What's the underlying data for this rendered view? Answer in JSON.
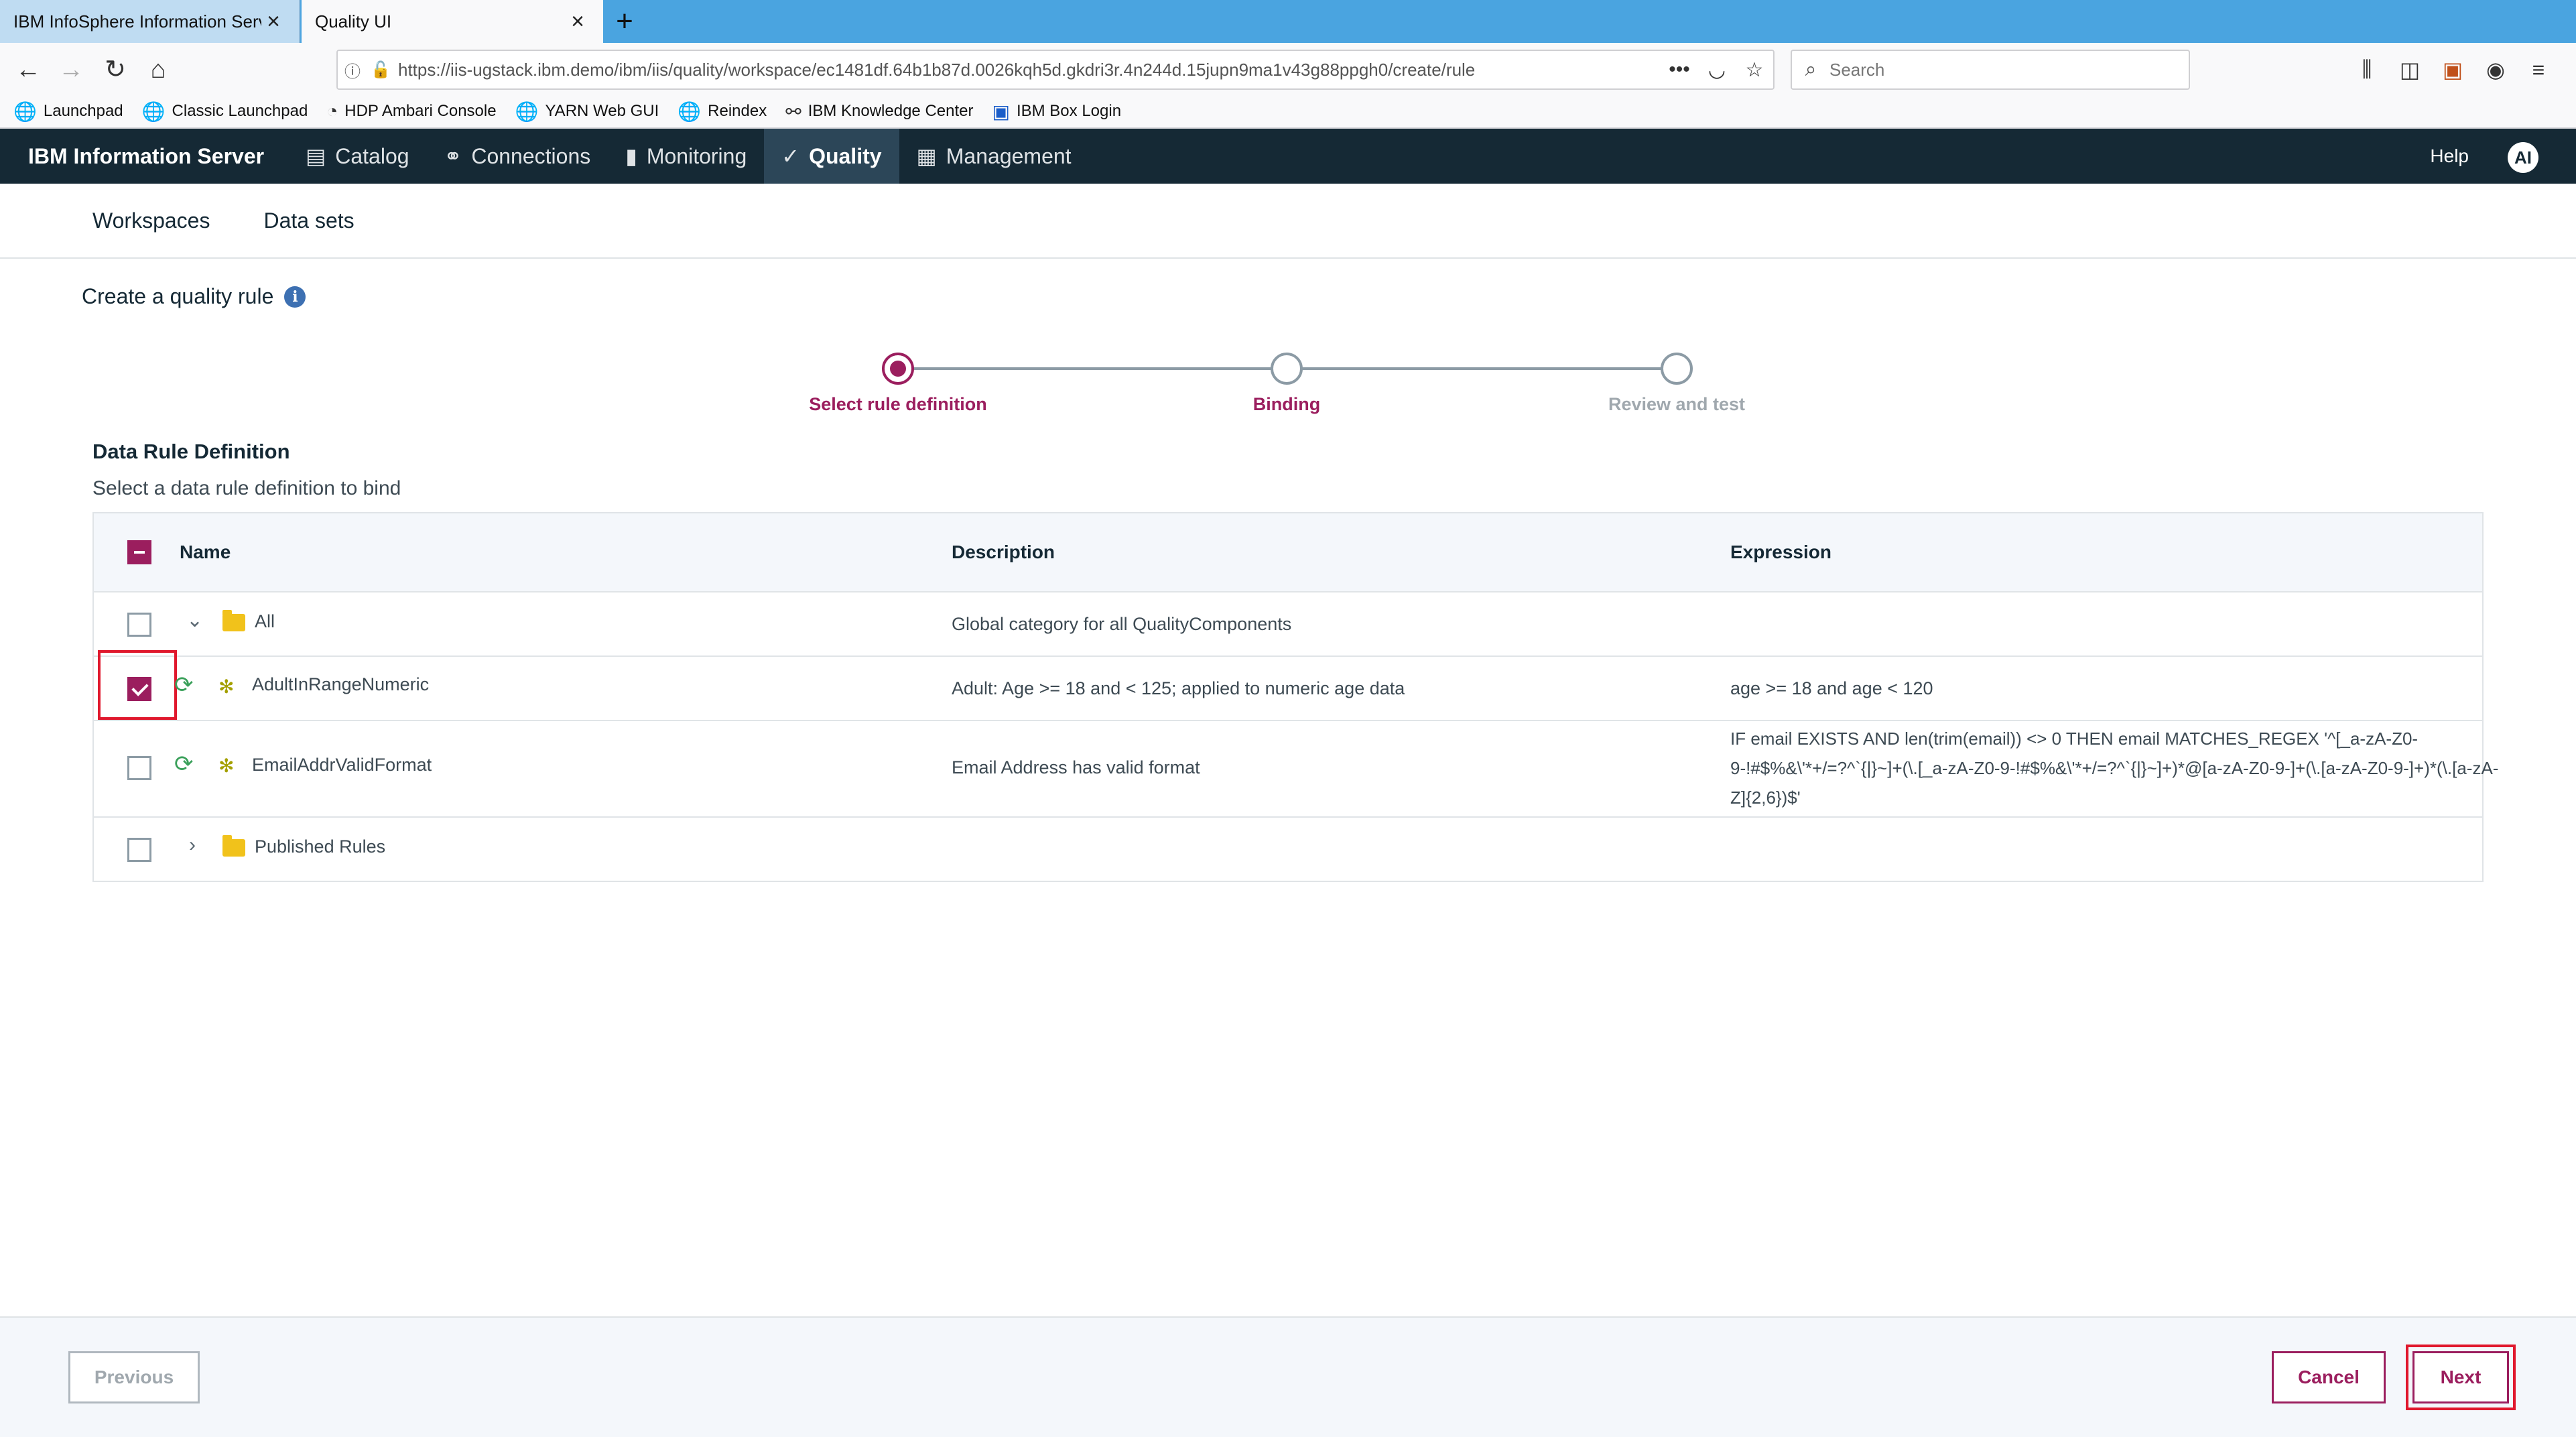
{
  "browser": {
    "tabs": [
      {
        "label": "IBM InfoSphere Information Server",
        "active": false
      },
      {
        "label": "Quality UI",
        "active": true
      }
    ],
    "url": "https://iis-ugstack.ibm.demo/ibm/iis/quality/workspace/ec1481df.64b1b87d.0026kqh5d.gkdri3r.4n244d.15jupn9ma1v43g88ppgh0/create/rule",
    "search_placeholder": "Search",
    "bookmarks": [
      {
        "label": "Launchpad",
        "icon": "globe-icon"
      },
      {
        "label": "Classic Launchpad",
        "icon": "globe-icon"
      },
      {
        "label": "HDP Ambari Console",
        "icon": "ambari-icon"
      },
      {
        "label": "YARN Web GUI",
        "icon": "globe-icon"
      },
      {
        "label": "Reindex",
        "icon": "globe-icon"
      },
      {
        "label": "IBM Knowledge Center",
        "icon": "knowledge-icon"
      },
      {
        "label": "IBM Box Login",
        "icon": "box-icon"
      }
    ]
  },
  "app": {
    "brand": "IBM Information Server",
    "nav": [
      {
        "label": "Catalog",
        "icon": "catalog-icon",
        "active": false
      },
      {
        "label": "Connections",
        "icon": "connections-icon",
        "active": false
      },
      {
        "label": "Monitoring",
        "icon": "monitoring-icon",
        "active": false
      },
      {
        "label": "Quality",
        "icon": "quality-check-icon",
        "active": true
      },
      {
        "label": "Management",
        "icon": "management-icon",
        "active": false
      }
    ],
    "help": "Help",
    "avatar": "AI"
  },
  "subnav": [
    "Workspaces",
    "Data sets"
  ],
  "page": {
    "title": "Create a quality rule",
    "steps": [
      {
        "label": "Select rule definition",
        "state": "current"
      },
      {
        "label": "Binding",
        "state": "next"
      },
      {
        "label": "Review and test",
        "state": "future"
      }
    ],
    "section_title": "Data Rule Definition",
    "section_subtitle": "Select a data rule definition to bind"
  },
  "table": {
    "columns": [
      "Name",
      "Description",
      "Expression"
    ],
    "rows": [
      {
        "type": "folder",
        "expanded": true,
        "name": "All",
        "description": "Global category for all QualityComponents",
        "expression": "",
        "checked": false
      },
      {
        "type": "rule",
        "name": "AdultInRangeNumeric",
        "description": "Adult: Age >= 18 and < 125; applied to numeric age data",
        "expression": "age >= 18 and age < 120",
        "checked": true
      },
      {
        "type": "rule",
        "name": "EmailAddrValidFormat",
        "description": "Email Address has valid format",
        "expression": "IF email EXISTS AND len(trim(email)) <> 0 THEN email MATCHES_REGEX '^[_a-zA-Z0-9-!#$%&\\'*+/=?^`{|}~]+(\\.[_a-zA-Z0-9-!#$%&\\'*+/=?^`{|}~]+)*@[a-zA-Z0-9-]+(\\.[a-zA-Z0-9-]+)*(\\.[a-zA-Z]{2,6})$'",
        "checked": false
      },
      {
        "type": "folder",
        "expanded": false,
        "name": "Published Rules",
        "description": "",
        "expression": "",
        "checked": false
      }
    ]
  },
  "footer": {
    "previous": "Previous",
    "cancel": "Cancel",
    "next": "Next"
  },
  "colors": {
    "accent": "#9b1e5e",
    "header_bg": "#152935",
    "highlight": "#e0182d"
  }
}
